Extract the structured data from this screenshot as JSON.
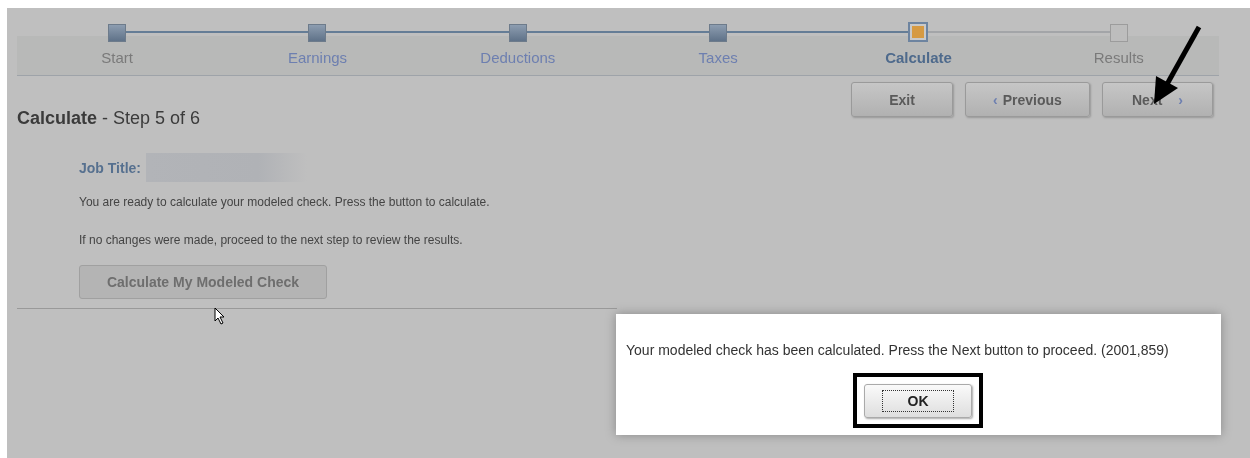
{
  "steps": [
    {
      "label": "Start",
      "done": true,
      "link": false,
      "selected": false
    },
    {
      "label": "Earnings",
      "done": true,
      "link": true,
      "selected": false
    },
    {
      "label": "Deductions",
      "done": true,
      "link": true,
      "selected": false
    },
    {
      "label": "Taxes",
      "done": true,
      "link": true,
      "selected": false
    },
    {
      "label": "Calculate",
      "done": false,
      "link": false,
      "selected": true
    },
    {
      "label": "Results",
      "done": false,
      "link": false,
      "selected": false
    }
  ],
  "nav_buttons": [
    {
      "label": "Exit",
      "kind": "plain"
    },
    {
      "label": "Previous",
      "kind": "back",
      "icon": "‹"
    },
    {
      "label": "Next",
      "kind": "forward",
      "icon": "›"
    }
  ],
  "heading": {
    "title": "Calculate",
    "separator": "-",
    "subtitle": "Step 5 of 6"
  },
  "job_title": {
    "label": "Job Title:"
  },
  "instructions": [
    "You are ready to calculate your modeled check. Press the button to calculate.",
    "If no changes were made, proceed to the next step to review the results."
  ],
  "calculate_button": {
    "label": "Calculate My Modeled Check",
    "disabled": true
  },
  "dialog": {
    "message": "Your modeled check has been calculated. Press the Next button to proceed. (2001,859)",
    "button": "OK"
  }
}
